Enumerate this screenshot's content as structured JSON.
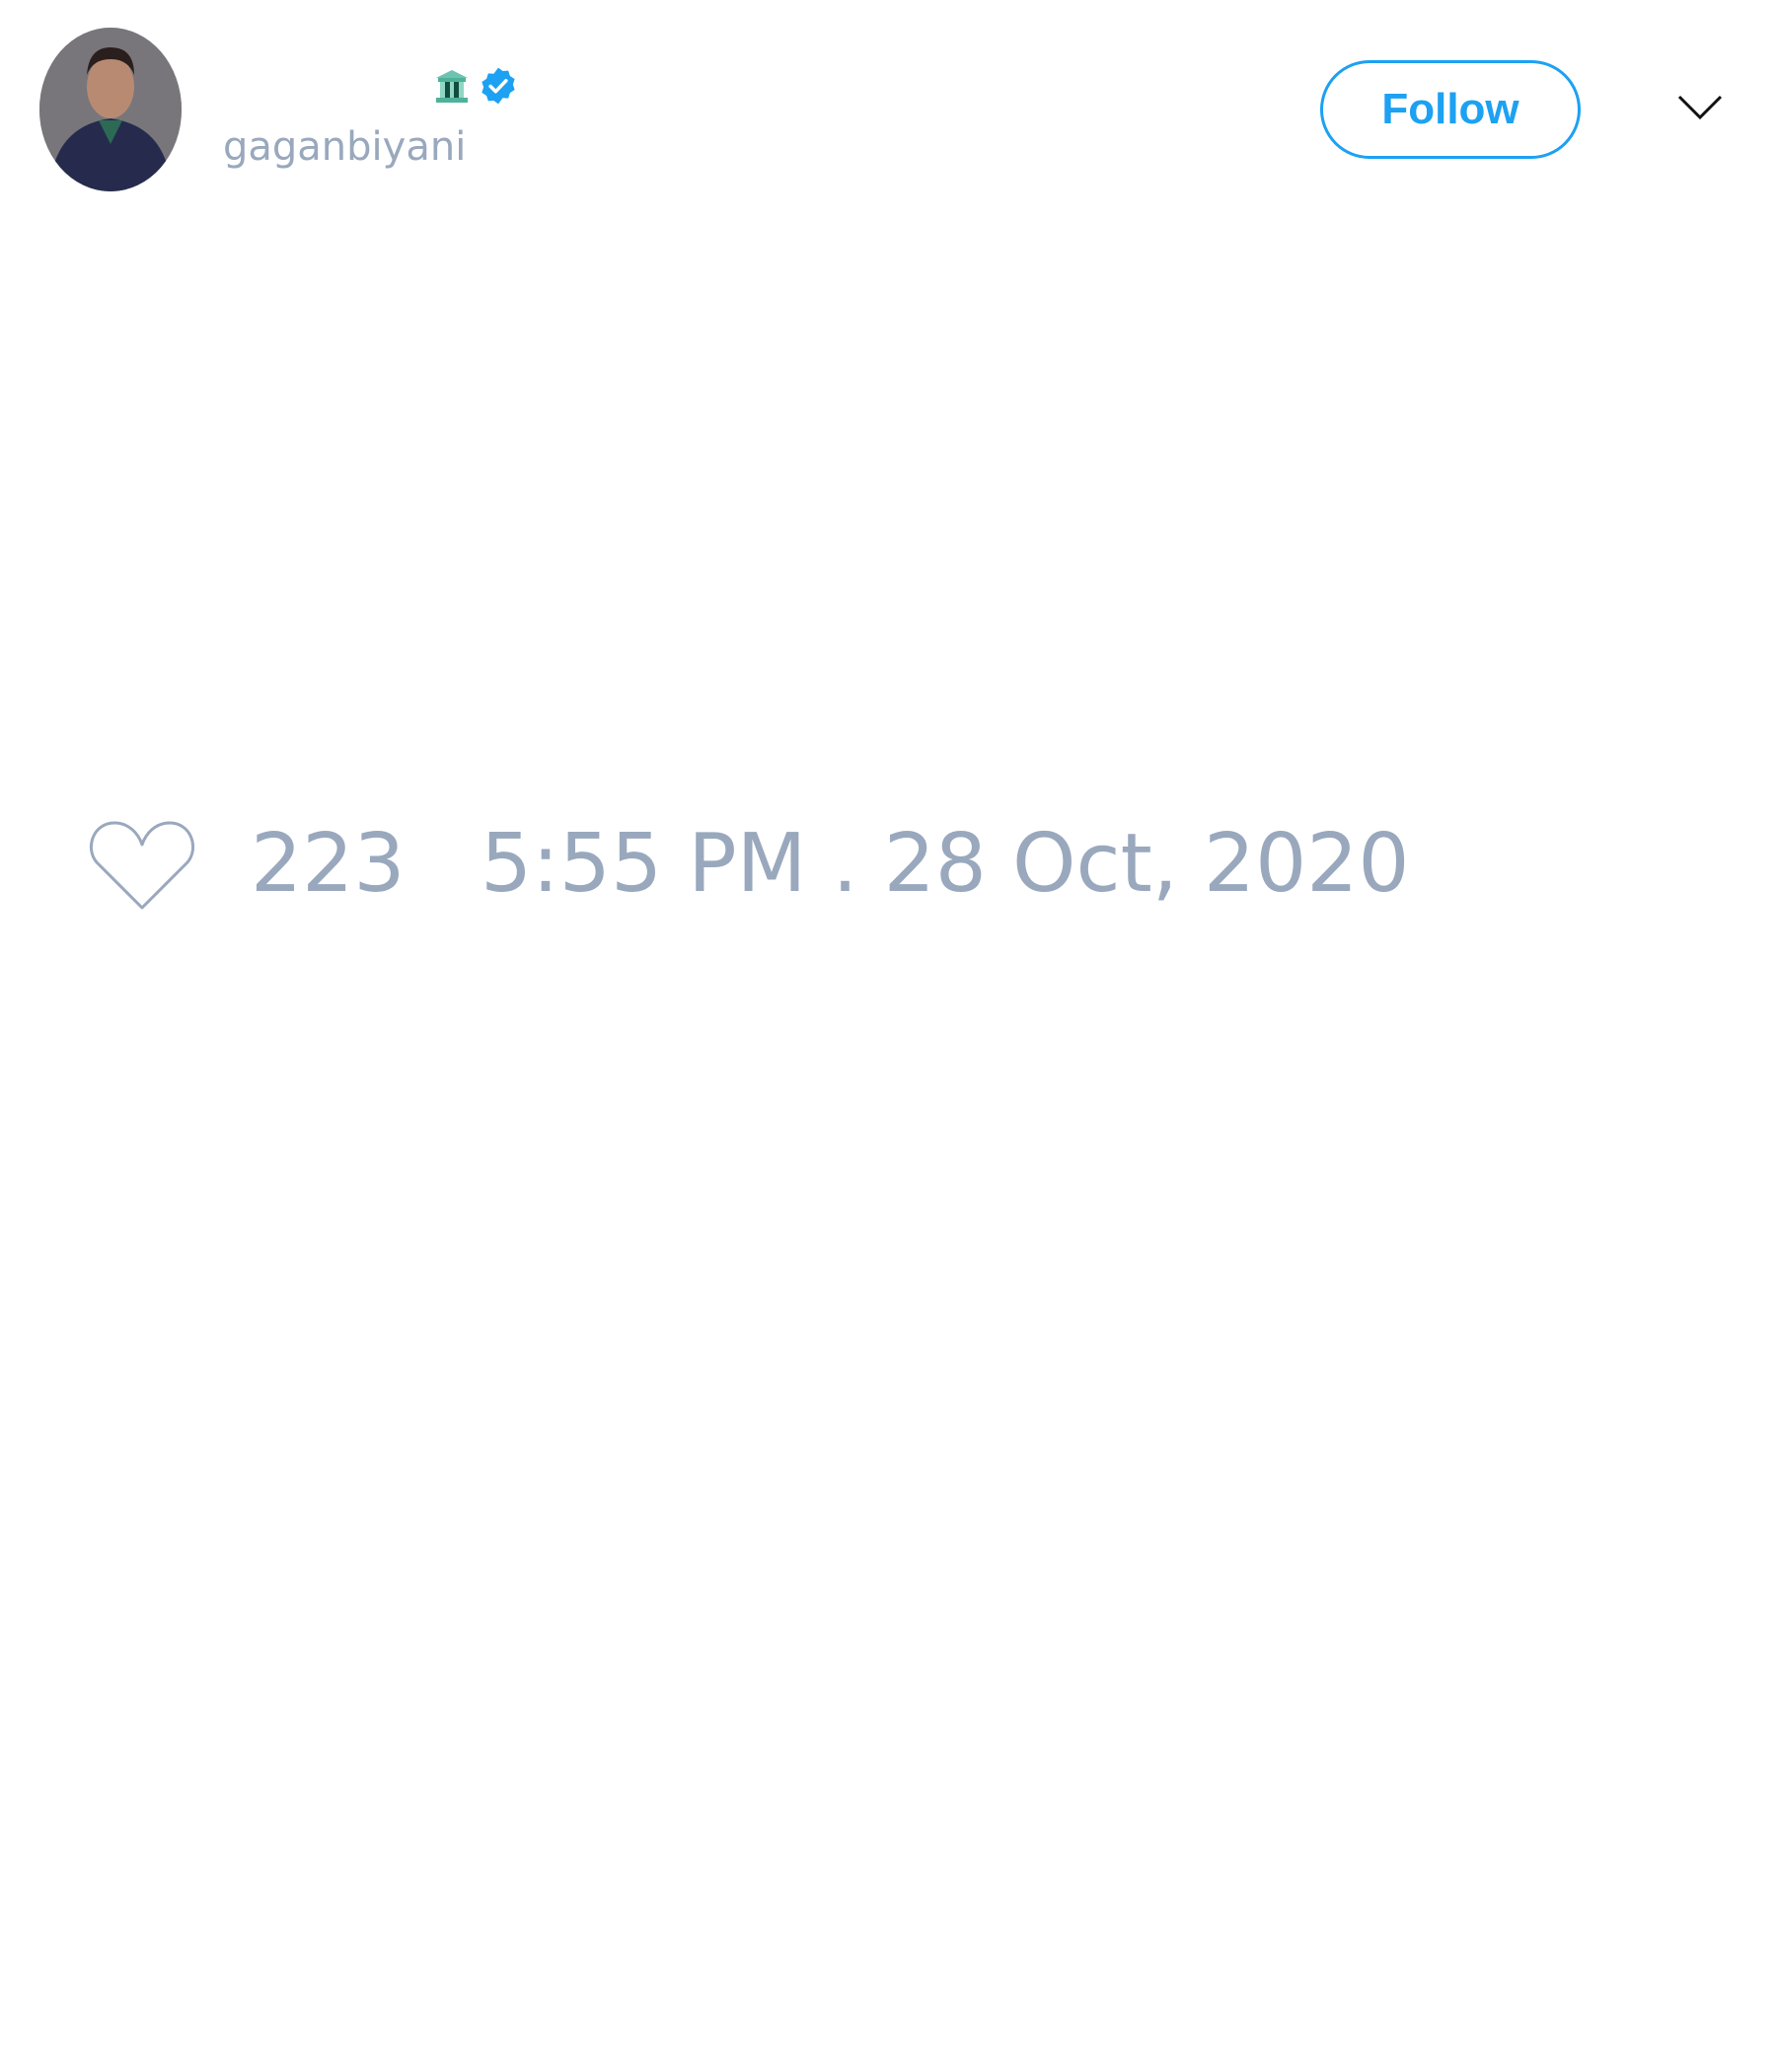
{
  "header": {
    "username": "gaganbiyani",
    "follow_label": "Follow",
    "icons": [
      "bank-emoji-icon",
      "verified-badge-icon",
      "chevron-down-icon"
    ]
  },
  "tweet": {
    "likes": "223",
    "timestamp": "5:55 PM . 28 Oct, 2020"
  },
  "colors": {
    "accent": "#1da1f2",
    "muted_text": "#99a8bd"
  }
}
